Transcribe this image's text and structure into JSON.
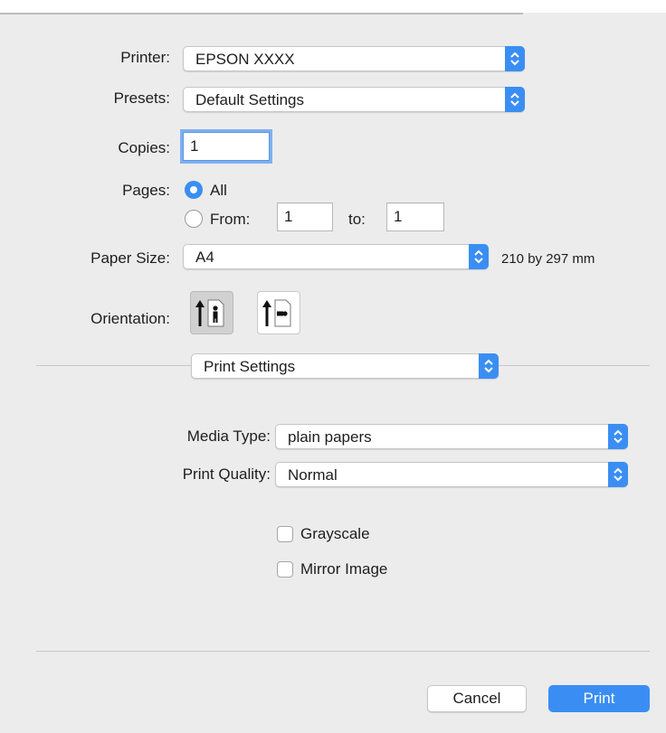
{
  "printer": {
    "label": "Printer:",
    "value": "EPSON XXXX"
  },
  "presets": {
    "label": "Presets:",
    "value": "Default Settings"
  },
  "copies": {
    "label": "Copies:",
    "value": "1"
  },
  "pages": {
    "label": "Pages:",
    "all_label": "All",
    "from_label": "From:",
    "from_value": "1",
    "to_label": "to:",
    "to_value": "1",
    "selected": "All"
  },
  "paper_size": {
    "label": "Paper Size:",
    "value": "A4",
    "dimensions": "210 by 297 mm"
  },
  "orientation": {
    "label": "Orientation:",
    "selected": "portrait",
    "options": [
      "portrait-icon",
      "landscape-icon"
    ]
  },
  "section": {
    "value": "Print Settings"
  },
  "media_type": {
    "label": "Media Type:",
    "value": "plain papers"
  },
  "print_quality": {
    "label": "Print Quality:",
    "value": "Normal"
  },
  "grayscale": {
    "label": "Grayscale",
    "checked": false
  },
  "mirror_image": {
    "label": "Mirror Image",
    "checked": false
  },
  "buttons": {
    "cancel": "Cancel",
    "print": "Print"
  },
  "colors": {
    "accent": "#3a8ef3",
    "background": "#ececec"
  }
}
